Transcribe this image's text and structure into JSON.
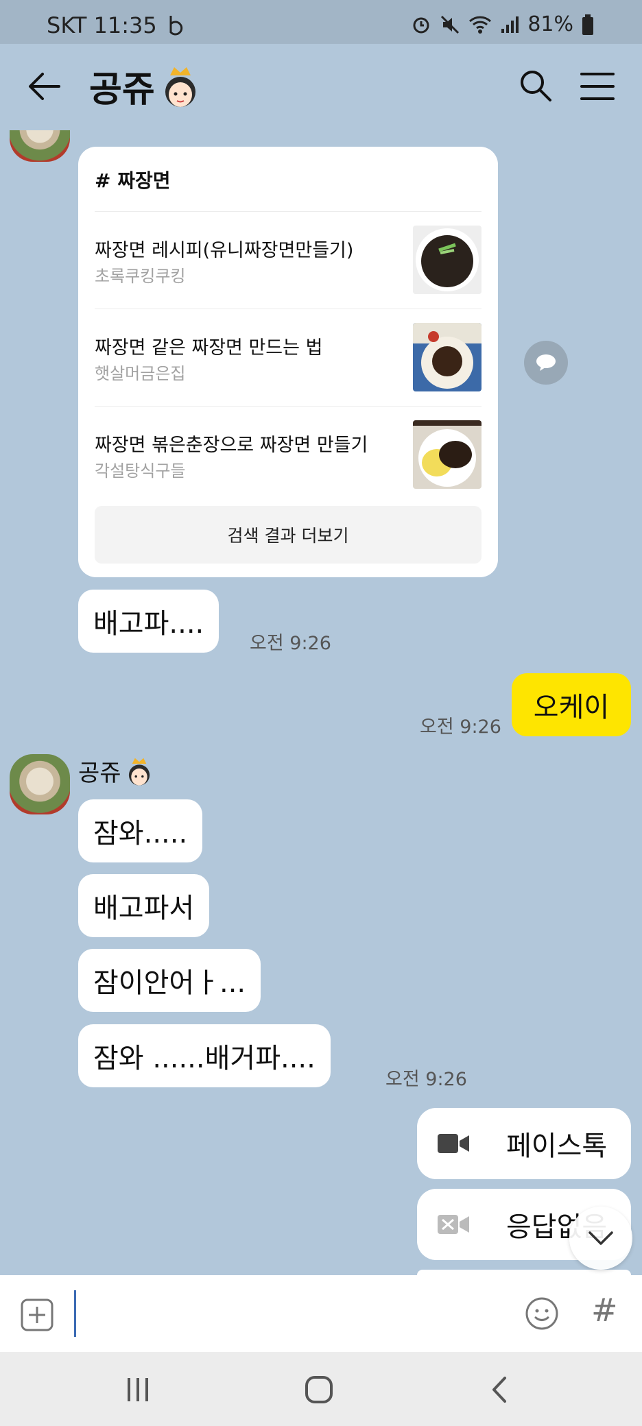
{
  "status_bar": {
    "carrier_time": "SKT 11:35",
    "battery": "81%"
  },
  "header": {
    "title": "공쥬"
  },
  "search_card": {
    "title": "# 짜장면",
    "results": [
      {
        "title": "짜장면 레시피(유니짜장면만들기)",
        "source": "초록쿠킹쿠킹"
      },
      {
        "title": "짜장면 같은 짜장면 만드는 법",
        "source": "햇살머금은집"
      },
      {
        "title": "짜장면 볶은춘장으로 짜장면 만들기",
        "source": "각설탕식구들"
      }
    ],
    "more_label": "검색 결과 더보기"
  },
  "messages": {
    "m1": "배고파....",
    "m1_time": "오전 9:26",
    "m2": "오케이",
    "m2_time": "오전 9:26",
    "sender": "공쥬",
    "m3": "잠와.....",
    "m4": "배고파서",
    "m5": "잠이안어ㅏ...",
    "m6": "잠와 ......배거파....",
    "m6_time": "오전 9:26",
    "call1": "페이스톡",
    "call2": "응답없음"
  },
  "input": {
    "placeholder": ""
  },
  "icons": {
    "back": "back-arrow-icon",
    "search": "search-icon",
    "menu": "menu-icon",
    "plus": "plus-icon",
    "emoji": "emoji-icon",
    "hash": "#"
  },
  "colors": {
    "chat_bg": "#b2c7da",
    "my_bubble": "#fee500",
    "other_bubble": "#ffffff"
  }
}
